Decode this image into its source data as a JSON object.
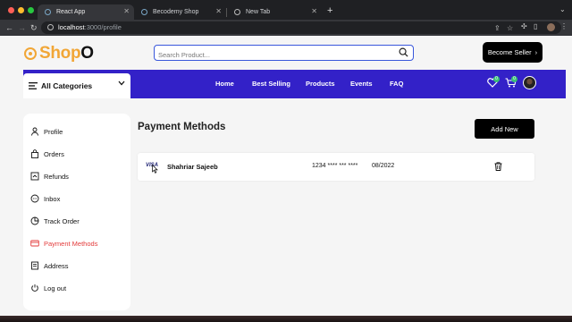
{
  "browser": {
    "tabs": [
      {
        "title": "React App",
        "active": true
      },
      {
        "title": "Becodemy Shop",
        "active": false
      },
      {
        "title": "New Tab",
        "active": false
      }
    ],
    "url_host": "localhost",
    "url_path": ":3000/profile"
  },
  "header": {
    "logo_main": "Shop",
    "logo_tail": "O",
    "search_placeholder": "Search Product...",
    "seller_button": "Become Seller",
    "seller_arrow": "›"
  },
  "nav": {
    "categories_label": "All Categories",
    "links": [
      "Home",
      "Best Selling",
      "Products",
      "Events",
      "FAQ"
    ],
    "wishlist_count": "0",
    "cart_count": "0"
  },
  "sidebar": {
    "items": [
      {
        "label": "Profile",
        "icon": "person-icon"
      },
      {
        "label": "Orders",
        "icon": "shopping-bag-icon"
      },
      {
        "label": "Refunds",
        "icon": "refund-icon"
      },
      {
        "label": "Inbox",
        "icon": "inbox-icon"
      },
      {
        "label": "Track Order",
        "icon": "track-icon"
      },
      {
        "label": "Payment Methods",
        "icon": "credit-card-icon",
        "active": true
      },
      {
        "label": "Address",
        "icon": "address-icon"
      },
      {
        "label": "Log out",
        "icon": "logout-icon"
      }
    ]
  },
  "main": {
    "title": "Payment Methods",
    "add_button": "Add New",
    "cards": [
      {
        "brand": "VISA",
        "holder": "Shahriar Sajeeb",
        "number": "1234 **** *** ****",
        "expiry": "08/2022"
      }
    ]
  },
  "colors": {
    "brand_orange": "#f1a636",
    "nav_blue": "#3321c8",
    "active_red": "#e33b3b",
    "badge_green": "#3bc177"
  }
}
